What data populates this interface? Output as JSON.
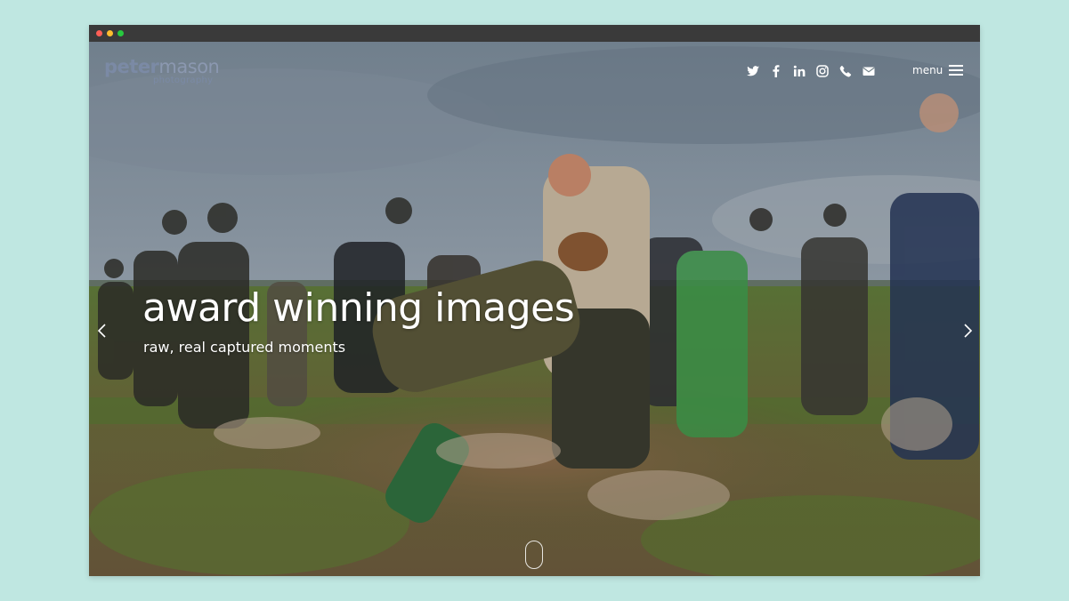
{
  "brand": {
    "name_part1": "peter",
    "name_part2": "mason",
    "tagline": "photography"
  },
  "nav": {
    "social_icons": [
      "twitter-icon",
      "facebook-icon",
      "linkedin-icon",
      "instagram-icon",
      "phone-icon",
      "envelope-icon"
    ],
    "menu_label": "menu"
  },
  "hero": {
    "headline": "award winning images",
    "subline": "raw, real captured moments"
  },
  "colors": {
    "page_background": "#bfe7e1",
    "titlebar": "#3a3a3a",
    "logo": "#7b8aa5",
    "overlay_text": "#ffffff"
  }
}
